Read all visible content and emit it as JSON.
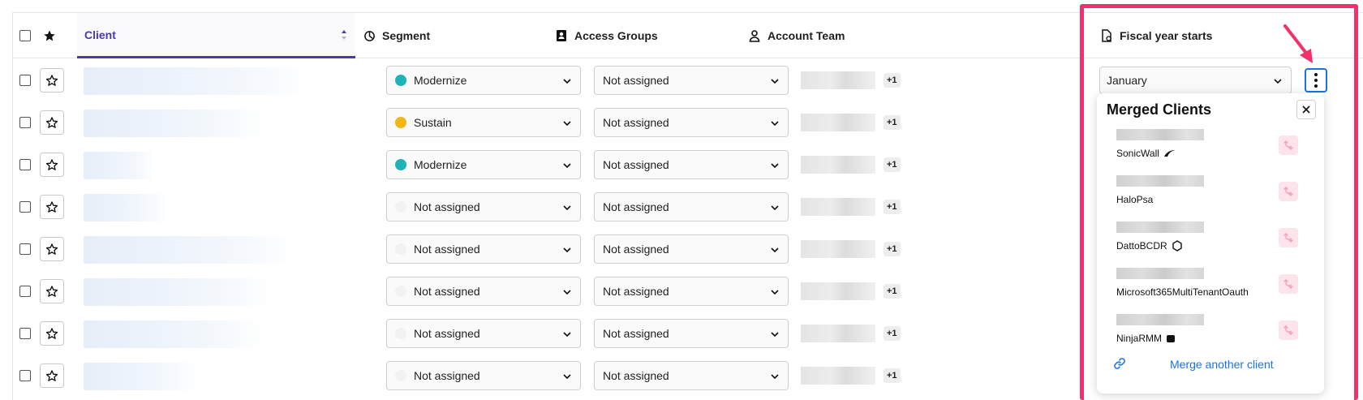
{
  "header": {
    "client": "Client",
    "segment": "Segment",
    "access_groups": "Access Groups",
    "account_team": "Account Team",
    "fiscal_year": "Fiscal year starts"
  },
  "rows": [
    {
      "segment": "Modernize",
      "segment_color": "#1eb3b8",
      "access": "Not assigned",
      "team_extra": "+1"
    },
    {
      "segment": "Sustain",
      "segment_color": "#f2b616",
      "access": "Not assigned",
      "team_extra": "+1"
    },
    {
      "segment": "Modernize",
      "segment_color": "#1eb3b8",
      "access": "Not assigned",
      "team_extra": "+1"
    },
    {
      "segment": "Not assigned",
      "segment_color": "#f2f2f2",
      "access": "Not assigned",
      "team_extra": "+1"
    },
    {
      "segment": "Not assigned",
      "segment_color": "#f2f2f2",
      "access": "Not assigned",
      "team_extra": "+1"
    },
    {
      "segment": "Not assigned",
      "segment_color": "#f2f2f2",
      "access": "Not assigned",
      "team_extra": "+1"
    },
    {
      "segment": "Not assigned",
      "segment_color": "#f2f2f2",
      "access": "Not assigned",
      "team_extra": "+1"
    },
    {
      "segment": "Not assigned",
      "segment_color": "#f2f2f2",
      "access": "Not assigned",
      "team_extra": "+1"
    }
  ],
  "fiscal_year_value": "January",
  "merged_clients": {
    "title": "Merged Clients",
    "items": [
      {
        "name": "SonicWall",
        "icon": "sonicwall-logo-icon"
      },
      {
        "name": "HaloPsa",
        "icon": ""
      },
      {
        "name": "DattoBCDR",
        "icon": "hexagon-icon"
      },
      {
        "name": "Microsoft365MultiTenantOauth",
        "icon": ""
      },
      {
        "name": "NinjaRMM",
        "icon": "ninja-logo-icon"
      }
    ],
    "merge_link": "Merge another client"
  },
  "colors": {
    "accent": "#4a3aa8",
    "highlight": "#f0316a",
    "link": "#1a73e8"
  }
}
